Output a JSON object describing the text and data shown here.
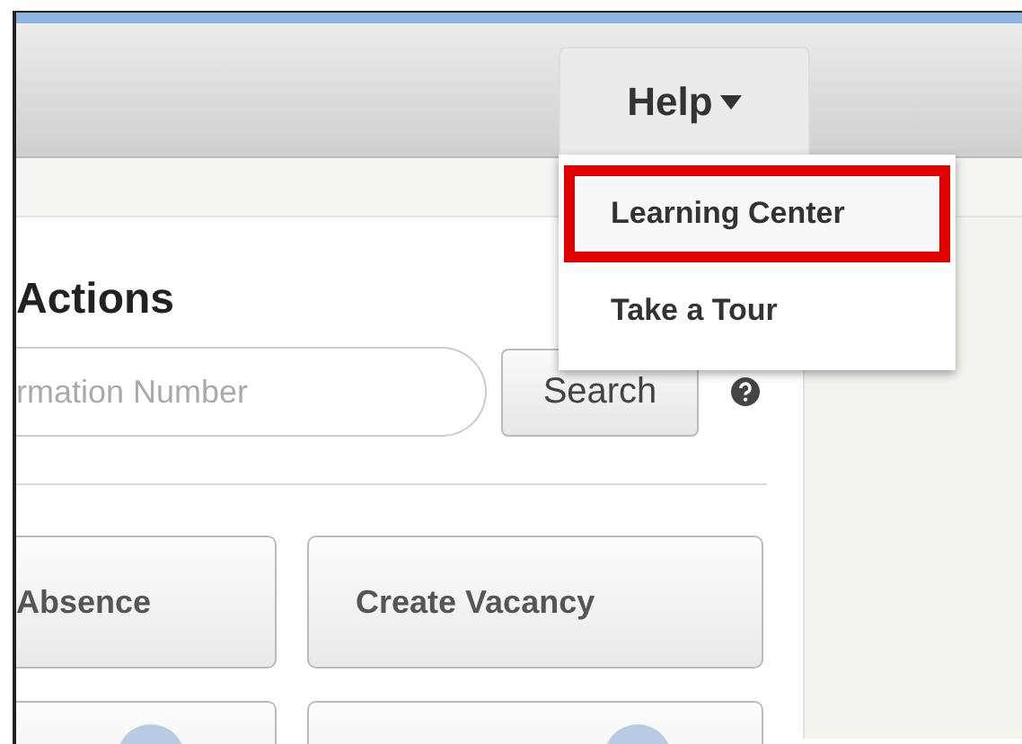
{
  "header": {
    "menu": {
      "label": "Help",
      "expanded": true
    }
  },
  "dropdown": {
    "items": [
      {
        "label": "Learning Center",
        "highlighted": true
      },
      {
        "label": "Take a Tour",
        "highlighted": false
      }
    ]
  },
  "panel": {
    "title": "Actions",
    "search": {
      "placeholder": "rmation Number",
      "button": "Search"
    },
    "actions": [
      {
        "kind": "text",
        "label": "Absence"
      },
      {
        "kind": "text",
        "label": "Create Vacancy"
      },
      {
        "kind": "icon"
      },
      {
        "kind": "icon"
      }
    ]
  }
}
